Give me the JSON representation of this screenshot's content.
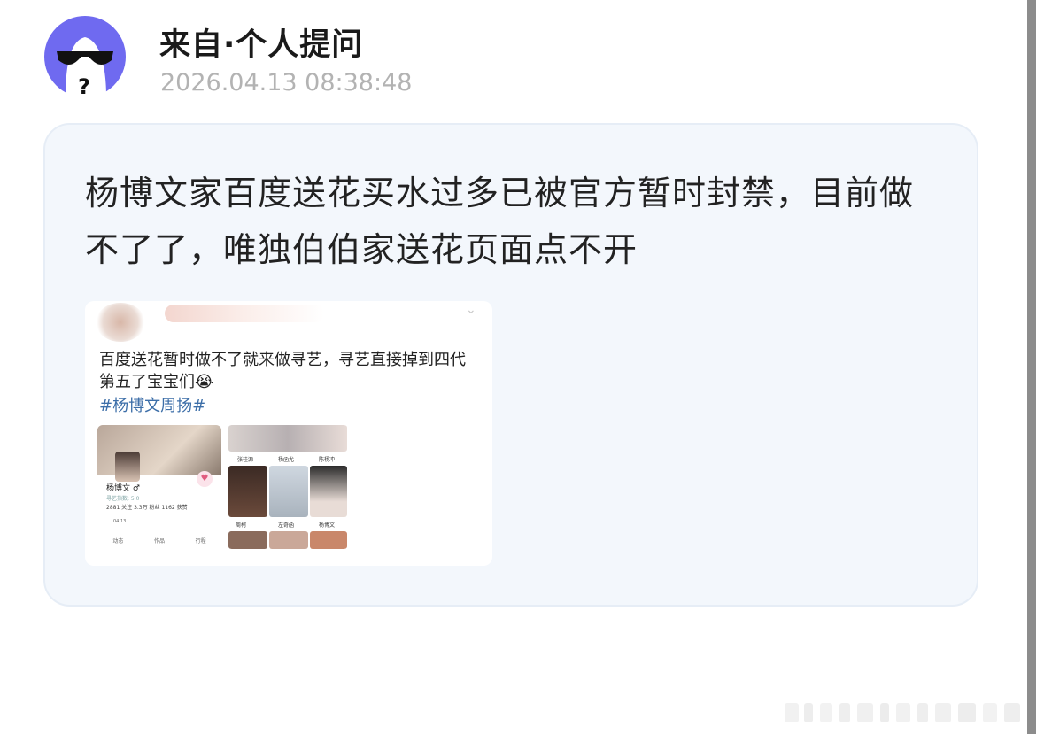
{
  "post": {
    "author": "来自·个人提问",
    "timestamp": "2026.04.13 08:38:48",
    "question": "杨博文家百度送花买水过多已被官方暂时封禁，目前做不了了，唯独伯伯家送花页面点不开"
  },
  "embedded": {
    "text": "百度送花暂时做不了就来做寻艺，寻艺直接掉到四代第五了宝宝们😭",
    "hashtag": "#杨博文周扬#",
    "profile_shot": {
      "name": "杨博文 ♂",
      "sub_label": "寻艺指数: 5.0",
      "stats": "2881 关注   3.3万 粉丝   1162 获赞",
      "date": "04.13",
      "tabs": [
        "动态",
        "作品",
        "行程"
      ]
    },
    "ranking_shot": {
      "labels": [
        "张桂源",
        "杨函尤",
        "陈杨冲",
        "周柯",
        "左奇函",
        "杨博文"
      ]
    }
  },
  "icons": {
    "avatar": "sunglasses-ghost-avatar-icon",
    "expand": "chevron-down-icon",
    "heart": "heart-icon"
  },
  "colors": {
    "avatar_bg": "#6f6af0",
    "card_bg": "#f3f7fc",
    "hashtag": "#3c6ea8",
    "timestamp": "#b3b3b3"
  }
}
